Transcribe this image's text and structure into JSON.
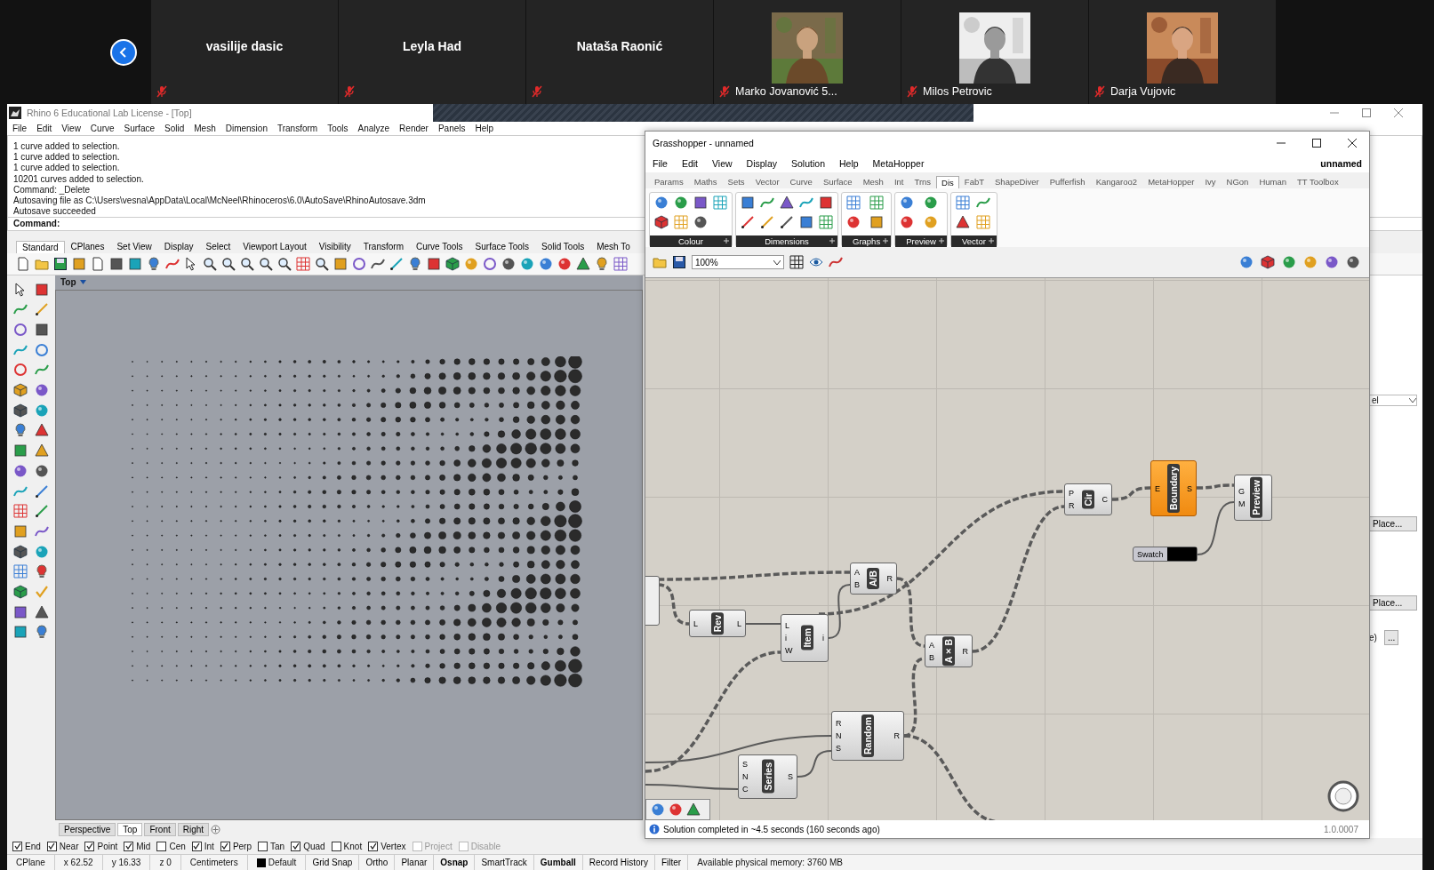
{
  "meeting": {
    "participants": [
      {
        "name": "vasilije dasic",
        "video": false,
        "muted": true
      },
      {
        "name": "Leyla Had",
        "video": false,
        "muted": true
      },
      {
        "name": "Nataša Raonić",
        "video": false,
        "muted": true
      },
      {
        "name": "Marko Jovanović 5...",
        "video": true,
        "muted": true
      },
      {
        "name": "Milos Petrovic",
        "video": true,
        "muted": true
      },
      {
        "name": "Darja Vujovic",
        "video": true,
        "muted": true
      }
    ]
  },
  "rhino": {
    "title": "Rhino 6 Educational Lab License - [Top]",
    "menu": [
      "File",
      "Edit",
      "View",
      "Curve",
      "Surface",
      "Solid",
      "Mesh",
      "Dimension",
      "Transform",
      "Tools",
      "Analyze",
      "Render",
      "Panels",
      "Help"
    ],
    "command_history": [
      "1 curve added to selection.",
      "1 curve added to selection.",
      "1 curve added to selection.",
      "10201 curves added to selection.",
      "Command: _Delete",
      "Autosaving file as C:\\Users\\vesna\\AppData\\Local\\McNeel\\Rhinoceros\\6.0\\AutoSave\\RhinoAutosave.3dm",
      "Autosave succeeded"
    ],
    "command_prompt": "Command:",
    "toolbar_tabs": [
      {
        "label": "Standard",
        "selected": true
      },
      {
        "label": "CPlanes",
        "selected": false
      },
      {
        "label": "Set View",
        "selected": false
      },
      {
        "label": "Display",
        "selected": false
      },
      {
        "label": "Select",
        "selected": false
      },
      {
        "label": "Viewport Layout",
        "selected": false
      },
      {
        "label": "Visibility",
        "selected": false
      },
      {
        "label": "Transform",
        "selected": false
      },
      {
        "label": "Curve Tools",
        "selected": false
      },
      {
        "label": "Surface Tools",
        "selected": false
      },
      {
        "label": "Solid Tools",
        "selected": false
      },
      {
        "label": "Mesh To",
        "selected": false
      }
    ],
    "viewport": {
      "title": "Top"
    },
    "viewport_tabs": [
      {
        "label": "Perspective",
        "selected": false
      },
      {
        "label": "Top",
        "selected": true
      },
      {
        "label": "Front",
        "selected": false
      },
      {
        "label": "Right",
        "selected": false
      }
    ],
    "osnaps": [
      {
        "label": "End",
        "checked": true,
        "disabled": false
      },
      {
        "label": "Near",
        "checked": true,
        "disabled": false
      },
      {
        "label": "Point",
        "checked": true,
        "disabled": false
      },
      {
        "label": "Mid",
        "checked": true,
        "disabled": false
      },
      {
        "label": "Cen",
        "checked": false,
        "disabled": false
      },
      {
        "label": "Int",
        "checked": true,
        "disabled": false
      },
      {
        "label": "Perp",
        "checked": true,
        "disabled": false
      },
      {
        "label": "Tan",
        "checked": false,
        "disabled": false
      },
      {
        "label": "Quad",
        "checked": true,
        "disabled": false
      },
      {
        "label": "Knot",
        "checked": false,
        "disabled": false
      },
      {
        "label": "Vertex",
        "checked": true,
        "disabled": false
      },
      {
        "label": "Project",
        "checked": false,
        "disabled": true
      },
      {
        "label": "Disable",
        "checked": false,
        "disabled": true
      }
    ],
    "status_bar": [
      {
        "kind": "field",
        "text": "CPlane"
      },
      {
        "kind": "field",
        "text": "x 62.52"
      },
      {
        "kind": "field",
        "text": "y 16.33"
      },
      {
        "kind": "field",
        "text": "z 0"
      },
      {
        "kind": "field",
        "text": "Centimeters"
      },
      {
        "kind": "layer",
        "text": "Default",
        "color": "#000000"
      },
      {
        "kind": "toggle",
        "text": "Grid Snap",
        "on": false
      },
      {
        "kind": "toggle",
        "text": "Ortho",
        "on": false
      },
      {
        "kind": "toggle",
        "text": "Planar",
        "on": false
      },
      {
        "kind": "toggle",
        "text": "Osnap",
        "on": true
      },
      {
        "kind": "toggle",
        "text": "SmartTrack",
        "on": false
      },
      {
        "kind": "toggle",
        "text": "Gumball",
        "on": true
      },
      {
        "kind": "toggle",
        "text": "Record History",
        "on": false
      },
      {
        "kind": "toggle",
        "text": "Filter",
        "on": false
      },
      {
        "kind": "memo",
        "text": "Available physical memory: 3760 MB"
      }
    ],
    "properties_panel": {
      "dropdown": "el",
      "buttons": [
        "Place...",
        "Place..."
      ],
      "field": "e)",
      "browse_button": "..."
    }
  },
  "grasshopper": {
    "title": "Grasshopper - unnamed",
    "menu": [
      "File",
      "Edit",
      "View",
      "Display",
      "Solution",
      "Help",
      "MetaHopper"
    ],
    "document": "unnamed",
    "tabs": [
      {
        "label": "Params",
        "selected": false
      },
      {
        "label": "Maths",
        "selected": false
      },
      {
        "label": "Sets",
        "selected": false
      },
      {
        "label": "Vector",
        "selected": false
      },
      {
        "label": "Curve",
        "selected": false
      },
      {
        "label": "Surface",
        "selected": false
      },
      {
        "label": "Mesh",
        "selected": false
      },
      {
        "label": "Int",
        "selected": false
      },
      {
        "label": "Trns",
        "selected": false
      },
      {
        "label": "Dis",
        "selected": true
      },
      {
        "label": "FabT",
        "selected": false
      },
      {
        "label": "ShapeDiver",
        "selected": false
      },
      {
        "label": "Pufferfish",
        "selected": false
      },
      {
        "label": "Kangaroo2",
        "selected": false
      },
      {
        "label": "MetaHopper",
        "selected": false
      },
      {
        "label": "Ivy",
        "selected": false
      },
      {
        "label": "NGon",
        "selected": false
      },
      {
        "label": "Human",
        "selected": false
      },
      {
        "label": "TT Toolbox",
        "selected": false
      }
    ],
    "ribbon_groups": [
      "Colour",
      "Dimensions",
      "Graphs",
      "Preview",
      "Vector"
    ],
    "zoom": "100%",
    "nodes": [
      {
        "kind": "component",
        "label": "Rev",
        "inputs": [
          "L"
        ],
        "outputs": [
          "L"
        ],
        "selected": false
      },
      {
        "kind": "component",
        "label": "Item",
        "inputs": [
          "L",
          "i",
          "W"
        ],
        "outputs": [
          "i"
        ],
        "selected": false
      },
      {
        "kind": "component",
        "label": "A/B",
        "inputs": [
          "A",
          "B"
        ],
        "outputs": [
          "R"
        ],
        "selected": false
      },
      {
        "kind": "component",
        "label": "A×B",
        "inputs": [
          "A",
          "B"
        ],
        "outputs": [
          "R"
        ],
        "selected": false
      },
      {
        "kind": "component",
        "label": "Cir",
        "inputs": [
          "P",
          "R"
        ],
        "outputs": [
          "C"
        ],
        "selected": false
      },
      {
        "kind": "component",
        "label": "Boundary",
        "inputs": [
          "E"
        ],
        "outputs": [
          "S"
        ],
        "selected": true
      },
      {
        "kind": "component",
        "label": "Preview",
        "inputs": [
          "G",
          "M"
        ],
        "selected": false
      },
      {
        "kind": "swatch",
        "label": "Swatch"
      },
      {
        "kind": "component",
        "label": "Random",
        "inputs": [
          "R",
          "N",
          "S"
        ],
        "outputs": [
          "R"
        ],
        "selected": false
      },
      {
        "kind": "component",
        "label": "Series",
        "inputs": [
          "S",
          "N",
          "C"
        ],
        "outputs": [
          "S"
        ],
        "selected": false
      }
    ],
    "status": "Solution completed in ~4.5 seconds (160 seconds ago)",
    "version": "1.0.0007"
  }
}
